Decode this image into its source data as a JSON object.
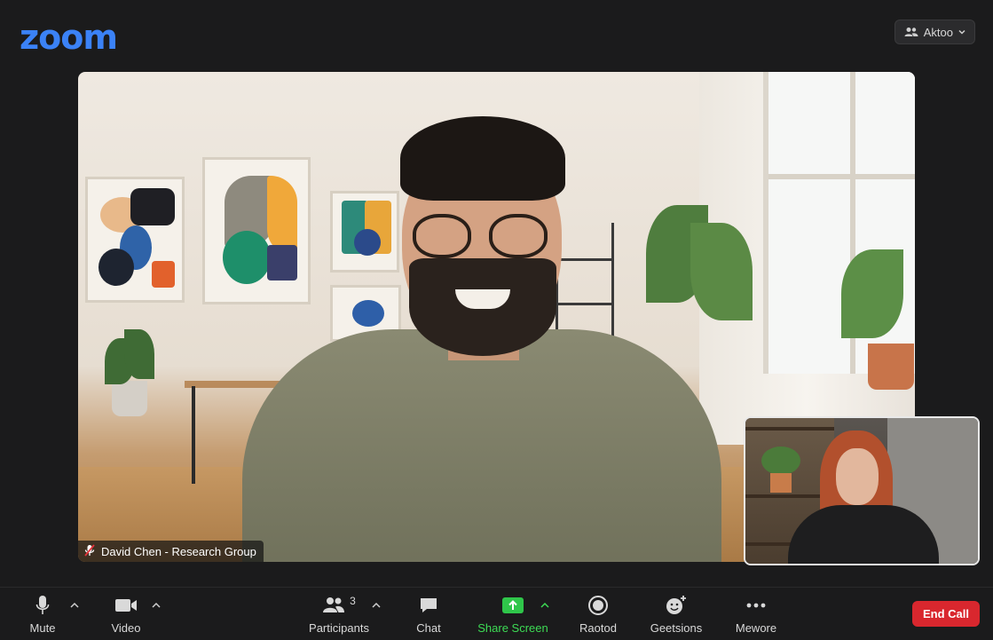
{
  "header": {
    "logo_text": "zoom",
    "view_button": {
      "label": "Aktoo",
      "icon": "people-icon"
    }
  },
  "main_video": {
    "participant_name": "David Chen - Research Group",
    "muted": true,
    "mute_icon": "mic-off-icon"
  },
  "self_view": {
    "label": ""
  },
  "toolbar": {
    "mute": {
      "label": "Mute",
      "icon": "microphone-icon"
    },
    "video": {
      "label": "Video",
      "icon": "video-camera-icon"
    },
    "participants": {
      "label": "Participants",
      "count": "3",
      "icon": "participants-icon"
    },
    "chat": {
      "label": "Chat",
      "icon": "chat-icon"
    },
    "share": {
      "label": "Share Screen",
      "icon": "share-screen-icon",
      "color": "#3ddc55"
    },
    "record": {
      "label": "Raotod",
      "icon": "record-icon"
    },
    "reactions": {
      "label": "Geetsions",
      "icon": "reactions-icon"
    },
    "more": {
      "label": "Mewore",
      "icon": "more-icon"
    },
    "end": {
      "label": "End Call",
      "color": "#d9272e"
    }
  },
  "colors": {
    "brand": "#3b82f6",
    "background": "#1b1b1c",
    "share_green": "#3ddc55",
    "end_red": "#d9272e"
  }
}
